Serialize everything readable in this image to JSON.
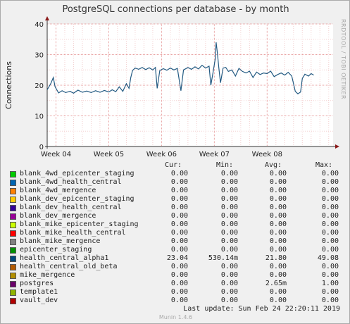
{
  "chart_data": {
    "type": "line",
    "title": "PostgreSQL connections per database - by month",
    "ylabel": "Connections",
    "xlabel": "",
    "ylim": [
      0,
      40
    ],
    "yticks": [
      0,
      10,
      20,
      30,
      40
    ],
    "xlim": [
      0,
      32.5
    ],
    "xticks": [
      {
        "label": "Week 04",
        "x": 1
      },
      {
        "label": "Week 05",
        "x": 7
      },
      {
        "label": "Week 06",
        "x": 13
      },
      {
        "label": "Week 07",
        "x": 19
      },
      {
        "label": "Week 08",
        "x": 25
      }
    ],
    "grid": true,
    "series": [
      {
        "name": "health_central_alpha1",
        "color": "#235a82",
        "points": [
          [
            0.0,
            18.5
          ],
          [
            0.4,
            20.5
          ],
          [
            0.7,
            22.5
          ],
          [
            0.9,
            19.5
          ],
          [
            1.3,
            17.5
          ],
          [
            1.7,
            18.2
          ],
          [
            2.1,
            17.6
          ],
          [
            2.6,
            18.0
          ],
          [
            3.0,
            17.4
          ],
          [
            3.5,
            18.4
          ],
          [
            4.0,
            17.7
          ],
          [
            4.5,
            18.1
          ],
          [
            5.0,
            17.6
          ],
          [
            5.5,
            18.2
          ],
          [
            6.0,
            17.7
          ],
          [
            6.5,
            18.3
          ],
          [
            7.0,
            17.8
          ],
          [
            7.4,
            18.5
          ],
          [
            7.8,
            17.9
          ],
          [
            8.2,
            19.5
          ],
          [
            8.6,
            18.0
          ],
          [
            9.0,
            20.5
          ],
          [
            9.3,
            19.0
          ],
          [
            9.5,
            22.5
          ],
          [
            9.7,
            24.8
          ],
          [
            10.0,
            25.6
          ],
          [
            10.4,
            25.2
          ],
          [
            10.8,
            25.8
          ],
          [
            11.2,
            25.1
          ],
          [
            11.6,
            25.7
          ],
          [
            12.0,
            25.0
          ],
          [
            12.3,
            25.8
          ],
          [
            12.5,
            19.0
          ],
          [
            12.8,
            24.8
          ],
          [
            13.2,
            25.4
          ],
          [
            13.6,
            24.9
          ],
          [
            14.0,
            25.6
          ],
          [
            14.4,
            25.0
          ],
          [
            14.8,
            25.5
          ],
          [
            15.2,
            18.2
          ],
          [
            15.5,
            25.0
          ],
          [
            16.0,
            25.8
          ],
          [
            16.4,
            25.2
          ],
          [
            16.8,
            26.0
          ],
          [
            17.2,
            25.3
          ],
          [
            17.6,
            26.5
          ],
          [
            18.0,
            25.6
          ],
          [
            18.4,
            26.2
          ],
          [
            18.6,
            20.0
          ],
          [
            18.9,
            25.0
          ],
          [
            19.1,
            28.5
          ],
          [
            19.2,
            34.0
          ],
          [
            19.35,
            30.5
          ],
          [
            19.5,
            26.0
          ],
          [
            19.7,
            20.8
          ],
          [
            20.0,
            25.6
          ],
          [
            20.3,
            25.8
          ],
          [
            20.6,
            24.5
          ],
          [
            21.0,
            25.0
          ],
          [
            21.4,
            23.0
          ],
          [
            21.8,
            25.5
          ],
          [
            22.2,
            24.5
          ],
          [
            22.6,
            24.0
          ],
          [
            23.0,
            24.6
          ],
          [
            23.4,
            22.5
          ],
          [
            23.8,
            24.3
          ],
          [
            24.2,
            23.5
          ],
          [
            24.6,
            24.0
          ],
          [
            25.0,
            23.8
          ],
          [
            25.4,
            24.6
          ],
          [
            25.8,
            22.8
          ],
          [
            26.2,
            23.5
          ],
          [
            26.6,
            24.0
          ],
          [
            27.0,
            23.3
          ],
          [
            27.4,
            24.2
          ],
          [
            27.8,
            23.0
          ],
          [
            28.2,
            18.0
          ],
          [
            28.5,
            17.2
          ],
          [
            28.8,
            17.8
          ],
          [
            29.0,
            22.2
          ],
          [
            29.3,
            23.6
          ],
          [
            29.7,
            23.0
          ],
          [
            30.0,
            23.8
          ],
          [
            30.3,
            23.3
          ]
        ]
      }
    ]
  },
  "legend": {
    "headers": {
      "cur": "Cur:",
      "min": "Min:",
      "avg": "Avg:",
      "max": "Max:"
    },
    "rows": [
      {
        "name": "blank_4wd_epicenter_staging",
        "color": "#00cc00",
        "cur": "0.00",
        "min": "0.00",
        "avg": "0.00",
        "max": "0.00"
      },
      {
        "name": "blank_4wd_health_central",
        "color": "#0066b3",
        "cur": "0.00",
        "min": "0.00",
        "avg": "0.00",
        "max": "0.00"
      },
      {
        "name": "blank_4wd_mergence",
        "color": "#ff8000",
        "cur": "0.00",
        "min": "0.00",
        "avg": "0.00",
        "max": "0.00"
      },
      {
        "name": "blank_dev_epicenter_staging",
        "color": "#ffcc00",
        "cur": "0.00",
        "min": "0.00",
        "avg": "0.00",
        "max": "0.00"
      },
      {
        "name": "blank_dev_health_central",
        "color": "#330099",
        "cur": "0.00",
        "min": "0.00",
        "avg": "0.00",
        "max": "0.00"
      },
      {
        "name": "blank_dev_mergence",
        "color": "#990099",
        "cur": "0.00",
        "min": "0.00",
        "avg": "0.00",
        "max": "0.00"
      },
      {
        "name": "blank_mike_epicenter_staging",
        "color": "#ccff00",
        "cur": "0.00",
        "min": "0.00",
        "avg": "0.00",
        "max": "0.00"
      },
      {
        "name": "blank_mike_health_central",
        "color": "#ff0000",
        "cur": "0.00",
        "min": "0.00",
        "avg": "0.00",
        "max": "0.00"
      },
      {
        "name": "blank_mike_mergence",
        "color": "#808080",
        "cur": "0.00",
        "min": "0.00",
        "avg": "0.00",
        "max": "0.00"
      },
      {
        "name": "epicenter_staging",
        "color": "#008f00",
        "cur": "0.00",
        "min": "0.00",
        "avg": "0.00",
        "max": "0.00"
      },
      {
        "name": "health_central_alpha1",
        "color": "#00487d",
        "cur": "23.04",
        "min": "530.14m",
        "avg": "21.80",
        "max": "49.08"
      },
      {
        "name": "health_central_old_beta",
        "color": "#b35a00",
        "cur": "0.00",
        "min": "0.00",
        "avg": "0.00",
        "max": "0.00"
      },
      {
        "name": "mike_mergence",
        "color": "#b38f00",
        "cur": "0.00",
        "min": "0.00",
        "avg": "0.00",
        "max": "0.00"
      },
      {
        "name": "postgres",
        "color": "#6b006b",
        "cur": "0.00",
        "min": "0.00",
        "avg": "2.65m",
        "max": "1.00"
      },
      {
        "name": "template1",
        "color": "#8fb300",
        "cur": "0.00",
        "min": "0.00",
        "avg": "0.00",
        "max": "0.00"
      },
      {
        "name": "vault_dev",
        "color": "#b30000",
        "cur": "0.00",
        "min": "0.00",
        "avg": "0.00",
        "max": "0.00"
      }
    ]
  },
  "last_update": "Last update:  Sun Feb 24 22:20:11 2019",
  "watermark": "RRDTOOL / TOBI OETIKER",
  "munin_version": "Munin 1.4.6",
  "colors": {
    "grid_major": "#e8a0a0",
    "grid_minor": "#f3d0d0",
    "axis": "#333333",
    "arrow": "#8b1a1a",
    "background": "#f0f0f0",
    "plot_bg": "#ffffff"
  }
}
